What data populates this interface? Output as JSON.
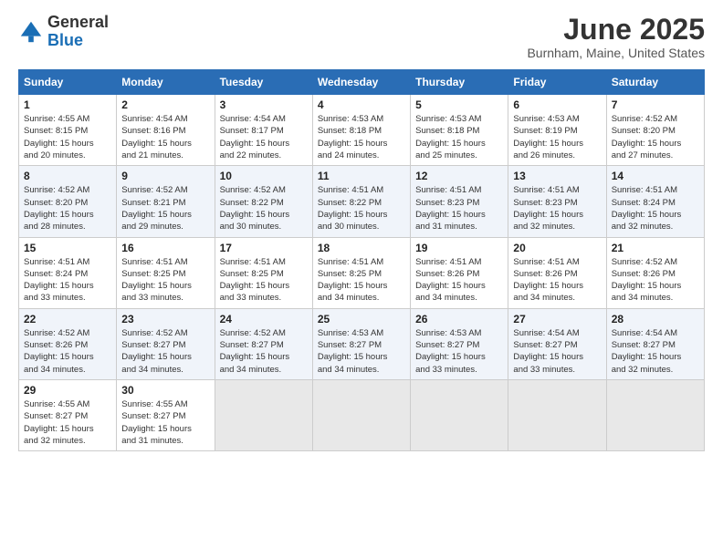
{
  "logo": {
    "general": "General",
    "blue": "Blue"
  },
  "header": {
    "month": "June 2025",
    "location": "Burnham, Maine, United States"
  },
  "weekdays": [
    "Sunday",
    "Monday",
    "Tuesday",
    "Wednesday",
    "Thursday",
    "Friday",
    "Saturday"
  ],
  "weeks": [
    [
      {
        "day": "1",
        "info": "Sunrise: 4:55 AM\nSunset: 8:15 PM\nDaylight: 15 hours\nand 20 minutes."
      },
      {
        "day": "2",
        "info": "Sunrise: 4:54 AM\nSunset: 8:16 PM\nDaylight: 15 hours\nand 21 minutes."
      },
      {
        "day": "3",
        "info": "Sunrise: 4:54 AM\nSunset: 8:17 PM\nDaylight: 15 hours\nand 22 minutes."
      },
      {
        "day": "4",
        "info": "Sunrise: 4:53 AM\nSunset: 8:18 PM\nDaylight: 15 hours\nand 24 minutes."
      },
      {
        "day": "5",
        "info": "Sunrise: 4:53 AM\nSunset: 8:18 PM\nDaylight: 15 hours\nand 25 minutes."
      },
      {
        "day": "6",
        "info": "Sunrise: 4:53 AM\nSunset: 8:19 PM\nDaylight: 15 hours\nand 26 minutes."
      },
      {
        "day": "7",
        "info": "Sunrise: 4:52 AM\nSunset: 8:20 PM\nDaylight: 15 hours\nand 27 minutes."
      }
    ],
    [
      {
        "day": "8",
        "info": "Sunrise: 4:52 AM\nSunset: 8:20 PM\nDaylight: 15 hours\nand 28 minutes."
      },
      {
        "day": "9",
        "info": "Sunrise: 4:52 AM\nSunset: 8:21 PM\nDaylight: 15 hours\nand 29 minutes."
      },
      {
        "day": "10",
        "info": "Sunrise: 4:52 AM\nSunset: 8:22 PM\nDaylight: 15 hours\nand 30 minutes."
      },
      {
        "day": "11",
        "info": "Sunrise: 4:51 AM\nSunset: 8:22 PM\nDaylight: 15 hours\nand 30 minutes."
      },
      {
        "day": "12",
        "info": "Sunrise: 4:51 AM\nSunset: 8:23 PM\nDaylight: 15 hours\nand 31 minutes."
      },
      {
        "day": "13",
        "info": "Sunrise: 4:51 AM\nSunset: 8:23 PM\nDaylight: 15 hours\nand 32 minutes."
      },
      {
        "day": "14",
        "info": "Sunrise: 4:51 AM\nSunset: 8:24 PM\nDaylight: 15 hours\nand 32 minutes."
      }
    ],
    [
      {
        "day": "15",
        "info": "Sunrise: 4:51 AM\nSunset: 8:24 PM\nDaylight: 15 hours\nand 33 minutes."
      },
      {
        "day": "16",
        "info": "Sunrise: 4:51 AM\nSunset: 8:25 PM\nDaylight: 15 hours\nand 33 minutes."
      },
      {
        "day": "17",
        "info": "Sunrise: 4:51 AM\nSunset: 8:25 PM\nDaylight: 15 hours\nand 33 minutes."
      },
      {
        "day": "18",
        "info": "Sunrise: 4:51 AM\nSunset: 8:25 PM\nDaylight: 15 hours\nand 34 minutes."
      },
      {
        "day": "19",
        "info": "Sunrise: 4:51 AM\nSunset: 8:26 PM\nDaylight: 15 hours\nand 34 minutes."
      },
      {
        "day": "20",
        "info": "Sunrise: 4:51 AM\nSunset: 8:26 PM\nDaylight: 15 hours\nand 34 minutes."
      },
      {
        "day": "21",
        "info": "Sunrise: 4:52 AM\nSunset: 8:26 PM\nDaylight: 15 hours\nand 34 minutes."
      }
    ],
    [
      {
        "day": "22",
        "info": "Sunrise: 4:52 AM\nSunset: 8:26 PM\nDaylight: 15 hours\nand 34 minutes."
      },
      {
        "day": "23",
        "info": "Sunrise: 4:52 AM\nSunset: 8:27 PM\nDaylight: 15 hours\nand 34 minutes."
      },
      {
        "day": "24",
        "info": "Sunrise: 4:52 AM\nSunset: 8:27 PM\nDaylight: 15 hours\nand 34 minutes."
      },
      {
        "day": "25",
        "info": "Sunrise: 4:53 AM\nSunset: 8:27 PM\nDaylight: 15 hours\nand 34 minutes."
      },
      {
        "day": "26",
        "info": "Sunrise: 4:53 AM\nSunset: 8:27 PM\nDaylight: 15 hours\nand 33 minutes."
      },
      {
        "day": "27",
        "info": "Sunrise: 4:54 AM\nSunset: 8:27 PM\nDaylight: 15 hours\nand 33 minutes."
      },
      {
        "day": "28",
        "info": "Sunrise: 4:54 AM\nSunset: 8:27 PM\nDaylight: 15 hours\nand 32 minutes."
      }
    ],
    [
      {
        "day": "29",
        "info": "Sunrise: 4:55 AM\nSunset: 8:27 PM\nDaylight: 15 hours\nand 32 minutes."
      },
      {
        "day": "30",
        "info": "Sunrise: 4:55 AM\nSunset: 8:27 PM\nDaylight: 15 hours\nand 31 minutes."
      },
      {
        "day": "",
        "info": ""
      },
      {
        "day": "",
        "info": ""
      },
      {
        "day": "",
        "info": ""
      },
      {
        "day": "",
        "info": ""
      },
      {
        "day": "",
        "info": ""
      }
    ]
  ]
}
